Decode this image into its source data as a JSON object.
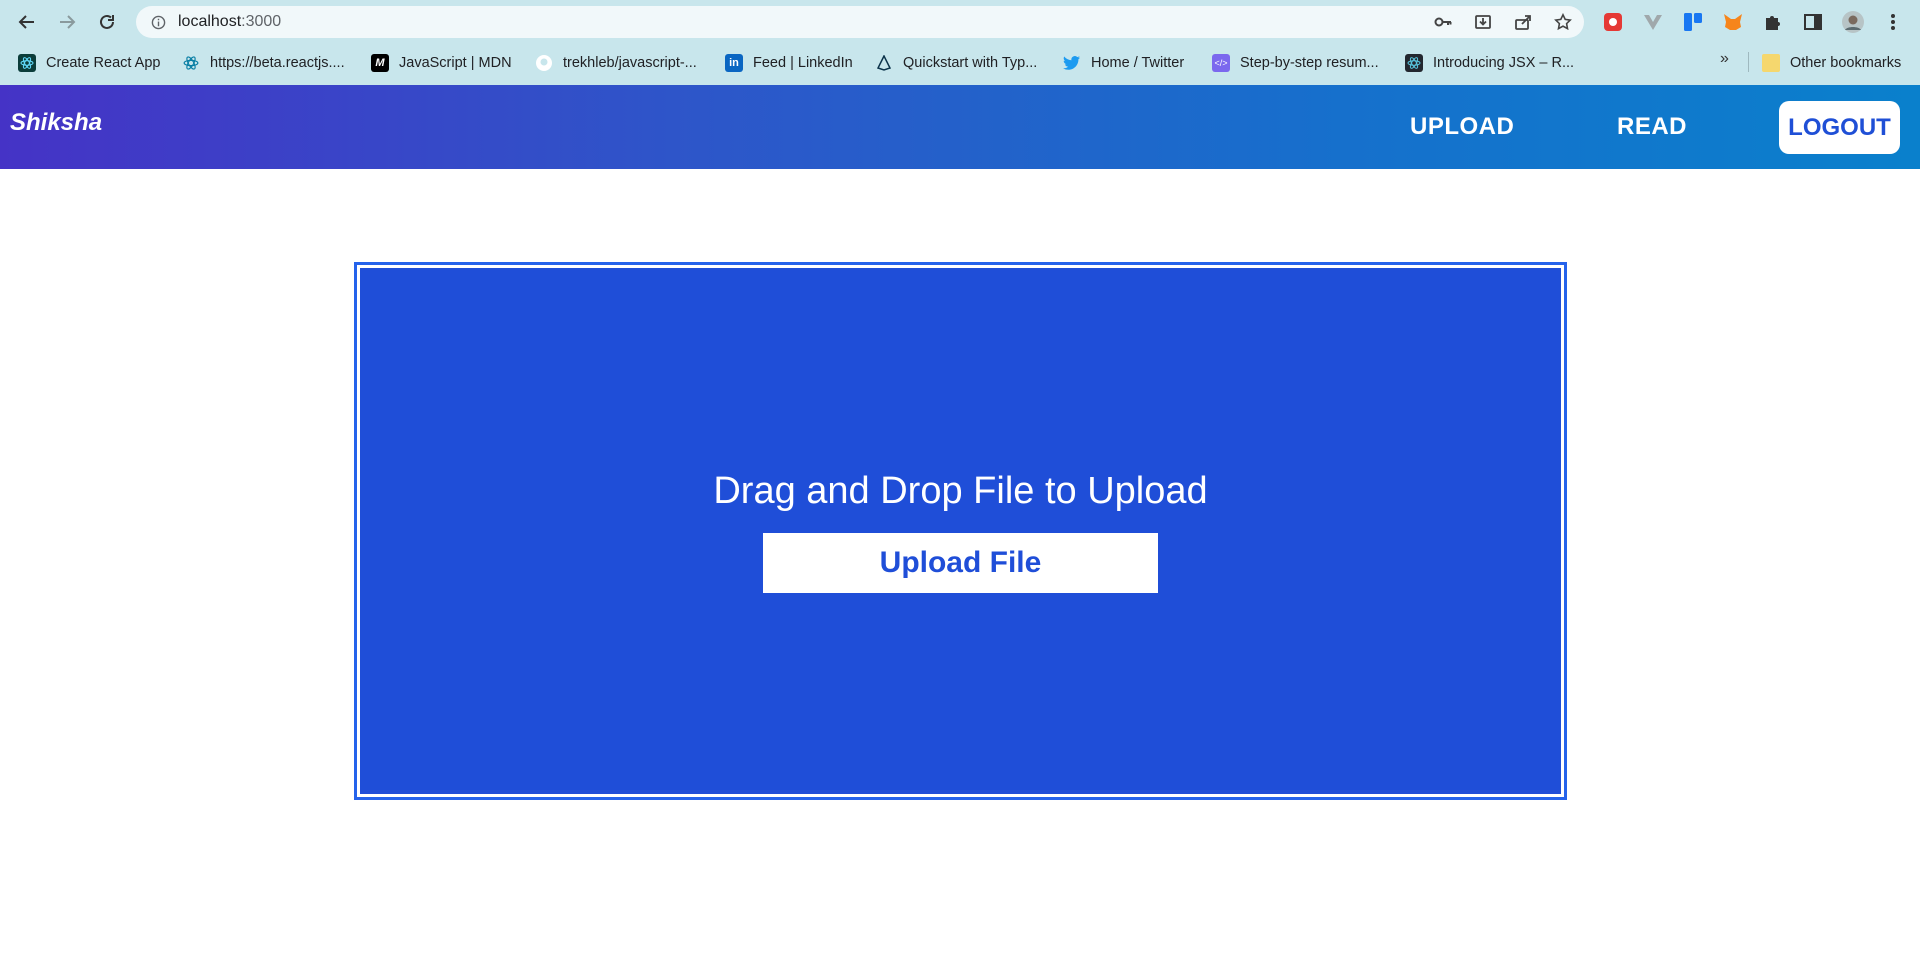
{
  "browser": {
    "url_host": "localhost",
    "url_port": ":3000",
    "bookmarks": [
      {
        "label": "Create React App",
        "icon": "react-icon",
        "color": "#0b3d3a"
      },
      {
        "label": "https://beta.reactjs....",
        "icon": "react-icon",
        "color": "#087ea4"
      },
      {
        "label": "JavaScript | MDN",
        "icon": "mdn-icon",
        "color": "#000000"
      },
      {
        "label": "trekhleb/javascript-...",
        "icon": "github-icon",
        "color": "#ffffff"
      },
      {
        "label": "Feed | LinkedIn",
        "icon": "linkedin-icon",
        "color": "#0a66c2"
      },
      {
        "label": "Quickstart with Typ...",
        "icon": "prisma-icon",
        "color": "#0c344b"
      },
      {
        "label": "Home / Twitter",
        "icon": "twitter-icon",
        "color": "#1d9bf0"
      },
      {
        "label": "Step-by-step resum...",
        "icon": "code-icon",
        "color": "#7b68ee"
      },
      {
        "label": "Introducing JSX – R...",
        "icon": "react-icon",
        "color": "#23272f"
      }
    ],
    "more_label": "»",
    "other_bookmarks": "Other bookmarks"
  },
  "app": {
    "brand": "Shiksha",
    "nav": {
      "upload": "UPLOAD",
      "read": "READ",
      "logout": "LOGOUT"
    },
    "dropzone": {
      "text": "Drag and Drop File to Upload",
      "button": "Upload File"
    },
    "colors": {
      "primary": "#1f4ed8",
      "navbar_start": "#4533c6",
      "navbar_end": "#0a80cc"
    }
  }
}
